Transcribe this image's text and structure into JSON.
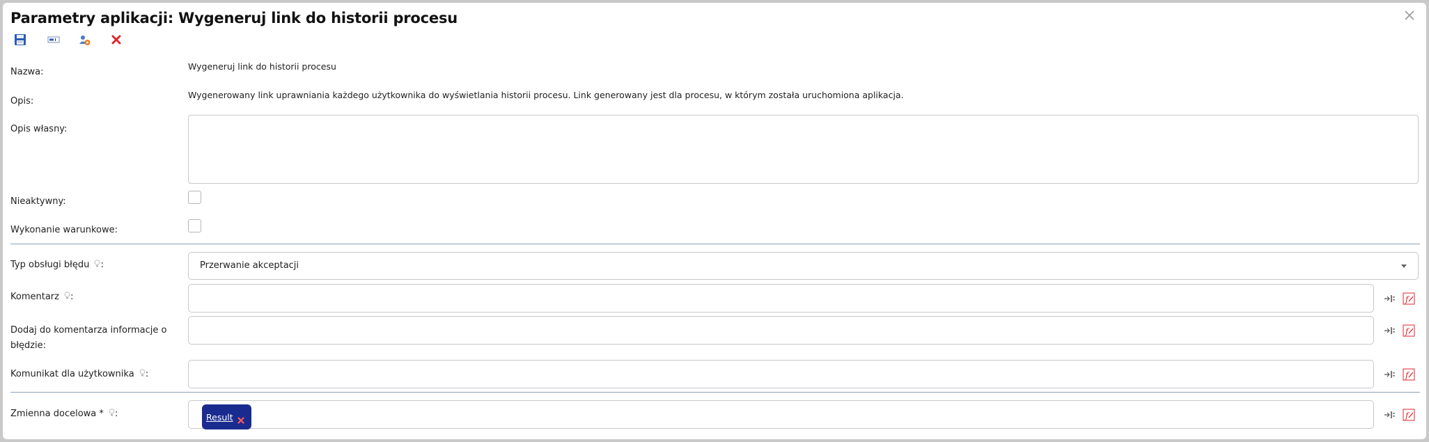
{
  "dialog": {
    "title": "Parametry aplikacji: Wygeneruj link do historii procesu"
  },
  "toolbar": {
    "items": [
      {
        "name": "save-icon"
      },
      {
        "name": "text-field-icon"
      },
      {
        "name": "user-config-icon"
      },
      {
        "name": "delete-icon"
      }
    ]
  },
  "form": {
    "name_label": "Nazwa:",
    "name_value": "Wygeneruj link do historii procesu",
    "description_label": "Opis:",
    "description_value": "Wygenerowany link uprawniania każdego użytkownika do wyświetlania historii procesu. Link generowany jest dla procesu, w którym została uruchomiona aplikacja.",
    "own_description_label": "Opis własny:",
    "own_description_value": "",
    "inactive_label": "Nieaktywny:",
    "inactive_checked": false,
    "conditional_label": "Wykonanie warunkowe:",
    "conditional_checked": false,
    "error_type_label": "Typ obsługi błędu",
    "error_type_value": "Przerwanie akceptacji",
    "comment_label": "Komentarz",
    "comment_value": "",
    "add_error_info_label": "Dodaj do komentarza informacje o błędzie:",
    "add_error_info_value": "",
    "user_message_label": "Komunikat dla użytkownika",
    "user_message_value": "",
    "target_variable_label": "Zmienna docelowa *",
    "target_variable_tag": "Result",
    "colon": ":"
  },
  "colors": {
    "tag_background": "#1a2b8f",
    "divider": "#8aa3b8",
    "accent_red": "#e0262d"
  }
}
